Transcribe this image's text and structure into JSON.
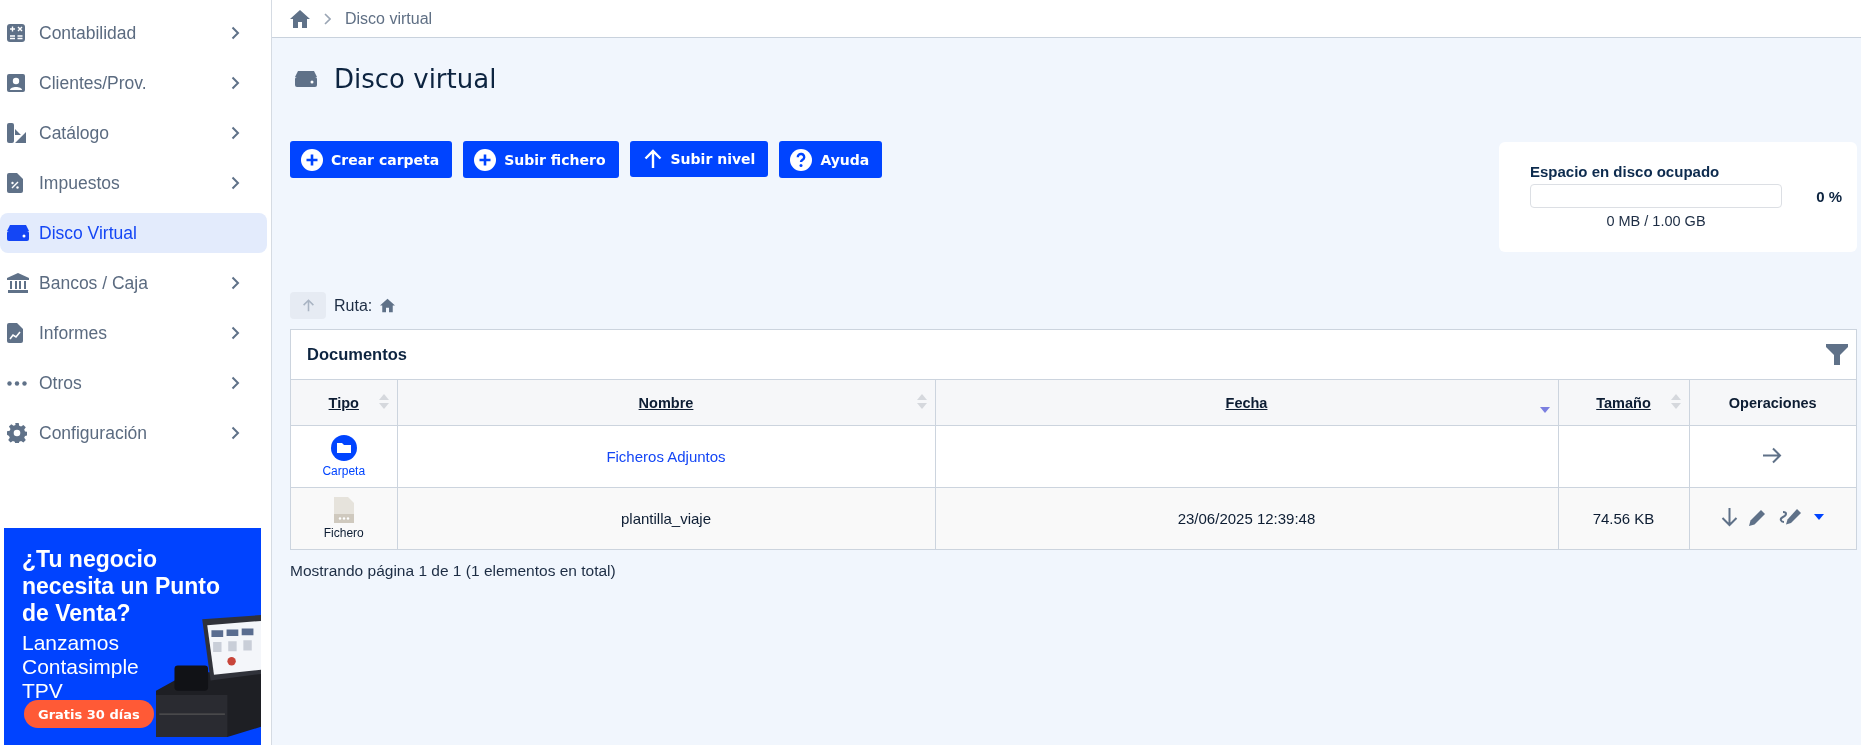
{
  "sidebar": {
    "items": [
      {
        "label": "Contabilidad",
        "selected": false,
        "expandable": true
      },
      {
        "label": "Clientes/Prov.",
        "selected": false,
        "expandable": true
      },
      {
        "label": "Catálogo",
        "selected": false,
        "expandable": true
      },
      {
        "label": "Impuestos",
        "selected": false,
        "expandable": true
      },
      {
        "label": "Disco Virtual",
        "selected": true,
        "expandable": false
      },
      {
        "label": "Bancos / Caja",
        "selected": false,
        "expandable": true
      },
      {
        "label": "Informes",
        "selected": false,
        "expandable": true
      },
      {
        "label": "Otros",
        "selected": false,
        "expandable": true
      },
      {
        "label": "Configuración",
        "selected": false,
        "expandable": true
      }
    ],
    "promo": {
      "headline": "¿Tu negocio necesita un Punto de Venta?",
      "body": "Lanzamos Contasimple TPV",
      "button": "Gratis 30 días"
    }
  },
  "breadcrumb": {
    "current": "Disco virtual"
  },
  "page_title": "Disco virtual",
  "toolbar": [
    {
      "label": "Crear carpeta",
      "kind": "add"
    },
    {
      "label": "Subir fichero",
      "kind": "add"
    },
    {
      "label": "Subir nivel",
      "kind": "up"
    },
    {
      "label": "Ayuda",
      "kind": "help"
    }
  ],
  "disk_usage": {
    "title": "Espacio en disco ocupado",
    "level": 0,
    "percent": "0 %",
    "usage": "0 MB / 1.00 GB"
  },
  "path": {
    "label": "Ruta:",
    "up_disabled": true
  },
  "table": {
    "title": "Documentos",
    "columns": [
      {
        "label": "Tipo",
        "sortable": true,
        "sorted": false
      },
      {
        "label": "Nombre",
        "sortable": true,
        "sorted": false
      },
      {
        "label": "Fecha",
        "sortable": true,
        "sorted": true
      },
      {
        "label": "Tamaño",
        "sortable": true,
        "sorted": false
      },
      {
        "label": "Operaciones",
        "sortable": false
      }
    ],
    "rows": [
      {
        "kind": "folder",
        "type": "Carpeta",
        "name": "Ficheros Adjuntos"
      },
      {
        "kind": "file",
        "type": "Fichero",
        "name": "plantilla_viaje",
        "date": "23/06/2025 12:39:48",
        "size": "74.56 KB"
      }
    ]
  },
  "footer": "Mostrando página 1 de 1 (1 elementos en total)"
}
